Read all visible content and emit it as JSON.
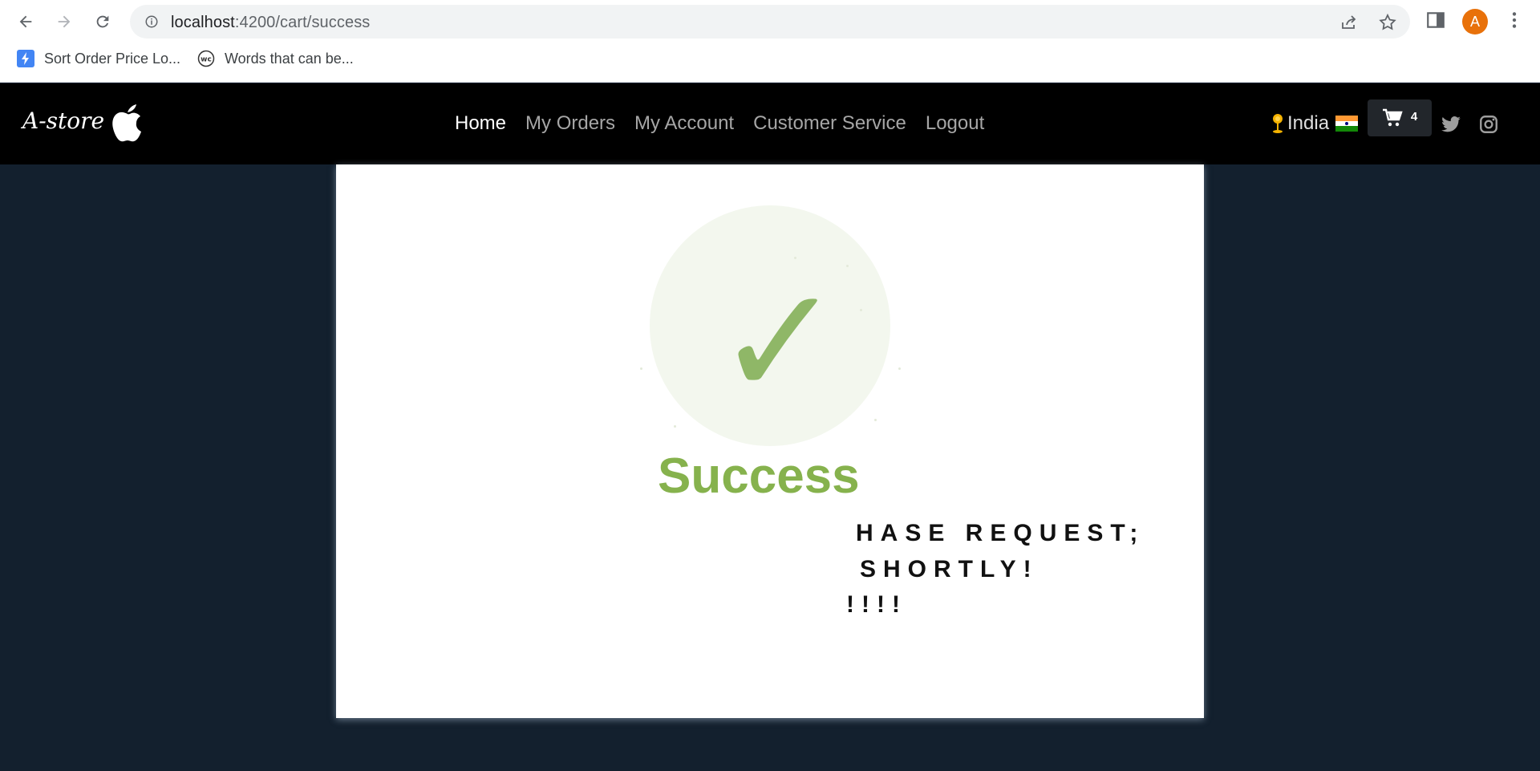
{
  "browser": {
    "url_host": "localhost",
    "url_path": ":4200/cart/success",
    "avatar_letter": "A",
    "bookmarks": [
      {
        "label": "Sort Order Price Lo...",
        "icon": "bolt-bookmark-icon"
      },
      {
        "label": "Words that can be...",
        "icon": "wc-bookmark-icon"
      }
    ]
  },
  "store": {
    "brand": "A-store",
    "menu": [
      {
        "label": "Home",
        "active": true
      },
      {
        "label": "My Orders",
        "active": false
      },
      {
        "label": "My Account",
        "active": false
      },
      {
        "label": "Customer Service",
        "active": false
      },
      {
        "label": "Logout",
        "active": false
      }
    ],
    "location": "India",
    "cart_count": "4"
  },
  "content": {
    "title": "Success",
    "lines": [
      "HASE REQUEST;",
      "SHORTLY!",
      "!!!!"
    ]
  },
  "colors": {
    "page_bg": "#13202e",
    "success_green": "#86b24d",
    "navbar_bg": "#000000"
  }
}
